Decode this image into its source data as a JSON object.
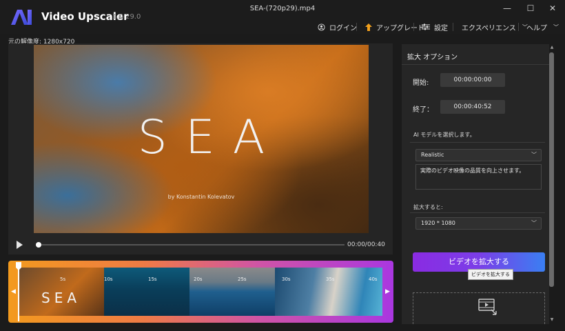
{
  "app": {
    "name": "Video Upscaler",
    "version": "1.0.29.0",
    "file": "SEA-(720p29).mp4",
    "logo_text": "AI"
  },
  "window": {
    "minimize": "—",
    "maximize": "☐",
    "close": "✕"
  },
  "menu": {
    "login": "ログイン",
    "upgrade": "アップグレード",
    "settings": "設定",
    "experience": "エクスペリエンス",
    "help": "ヘルプ"
  },
  "original_resolution": "元の解像度: 1280x720",
  "video": {
    "title": "SEA",
    "credit": "by Konstantin Kolevatov",
    "time": "00:00/00:40",
    "progress": 0
  },
  "timeline": {
    "ticks": [
      "5s",
      "10s",
      "15s",
      "20s",
      "25s",
      "30s",
      "35s",
      "40s"
    ],
    "left_arrow": "◀",
    "right_arrow": "▶",
    "thumb_title": "SEA"
  },
  "options": {
    "title": "拡大 オプション",
    "start_label": "開始:",
    "start_value": "00:00:00:00",
    "end_label": "終了：",
    "end_value": "00:00:40:52",
    "model_label": "AI モデルを選択します。",
    "model_value": "Realistic",
    "model_description": "実際のビデオ映像の品質を向上させます。",
    "scale_label": "拡大すると:",
    "scale_value": "1920 * 1080",
    "upscale_button": "ビデオを拡大する",
    "upscale_tooltip": "ビデオを拡大する"
  },
  "colors": {
    "accent_start": "#8a2be2",
    "accent_end": "#3a7ff2",
    "timeline_start": "#f39a1e",
    "timeline_end": "#a937e0"
  }
}
